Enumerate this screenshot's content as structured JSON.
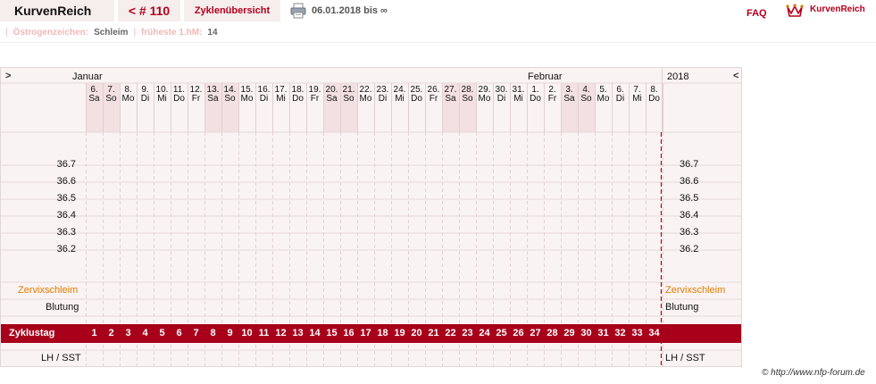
{
  "header": {
    "brand": "KurvenReich",
    "cycle": "< # 110",
    "overview": "Zyklenübersicht",
    "date_range": "06.01.2018 bis ∞",
    "faq": "FAQ",
    "logo_text": "KurvenReich"
  },
  "subbar": {
    "estrogen_label": "Östrogenzeichen:",
    "estrogen_value": "Schleim",
    "earliest_label": "früheste 1.hM:",
    "earliest_value": "14"
  },
  "chart": {
    "nav_prev": ">",
    "nav_next": "<",
    "month_jan": "Januar",
    "month_feb": "Februar",
    "year": "2018",
    "days": [
      {
        "d": "6.",
        "w": "Sa"
      },
      {
        "d": "7.",
        "w": "So"
      },
      {
        "d": "8.",
        "w": "Mo"
      },
      {
        "d": "9.",
        "w": "Di"
      },
      {
        "d": "10.",
        "w": "Mi"
      },
      {
        "d": "11.",
        "w": "Do"
      },
      {
        "d": "12.",
        "w": "Fr"
      },
      {
        "d": "13.",
        "w": "Sa"
      },
      {
        "d": "14.",
        "w": "So"
      },
      {
        "d": "15.",
        "w": "Mo"
      },
      {
        "d": "16.",
        "w": "Di"
      },
      {
        "d": "17.",
        "w": "Mi"
      },
      {
        "d": "18.",
        "w": "Do"
      },
      {
        "d": "19.",
        "w": "Fr"
      },
      {
        "d": "20.",
        "w": "Sa"
      },
      {
        "d": "21.",
        "w": "So"
      },
      {
        "d": "22.",
        "w": "Mo"
      },
      {
        "d": "23.",
        "w": "Di"
      },
      {
        "d": "24.",
        "w": "Mi"
      },
      {
        "d": "25.",
        "w": "Do"
      },
      {
        "d": "26.",
        "w": "Fr"
      },
      {
        "d": "27.",
        "w": "Sa"
      },
      {
        "d": "28.",
        "w": "So"
      },
      {
        "d": "29.",
        "w": "Mo"
      },
      {
        "d": "30.",
        "w": "Di"
      },
      {
        "d": "31.",
        "w": "Mi"
      },
      {
        "d": "1.",
        "w": "Do"
      },
      {
        "d": "2.",
        "w": "Fr"
      },
      {
        "d": "3.",
        "w": "Sa"
      },
      {
        "d": "4.",
        "w": "So"
      },
      {
        "d": "5.",
        "w": "Mo"
      },
      {
        "d": "6.",
        "w": "Di"
      },
      {
        "d": "7.",
        "w": "Mi"
      },
      {
        "d": "8.",
        "w": "Do"
      }
    ],
    "temperatures": [
      "36.7",
      "36.6",
      "36.5",
      "36.4",
      "36.3",
      "36.2"
    ],
    "row_mucus": "Zervixschleim",
    "row_bleeding": "Blutung",
    "row_cycle_day": "Zyklustag",
    "row_lh": "LH / SST",
    "cycle_days": [
      "1",
      "2",
      "3",
      "4",
      "5",
      "6",
      "7",
      "8",
      "9",
      "10",
      "11",
      "12",
      "13",
      "14",
      "15",
      "16",
      "17",
      "18",
      "19",
      "20",
      "21",
      "22",
      "23",
      "24",
      "25",
      "26",
      "27",
      "28",
      "29",
      "30",
      "31",
      "32",
      "33",
      "34"
    ]
  },
  "footer": {
    "copyright": "© http://www.nfp-forum.de"
  },
  "colors": {
    "accent": "#b3001b",
    "band": "#a8001a",
    "weekend": "#f3e0e2",
    "mucus_label": "#e07b00"
  }
}
